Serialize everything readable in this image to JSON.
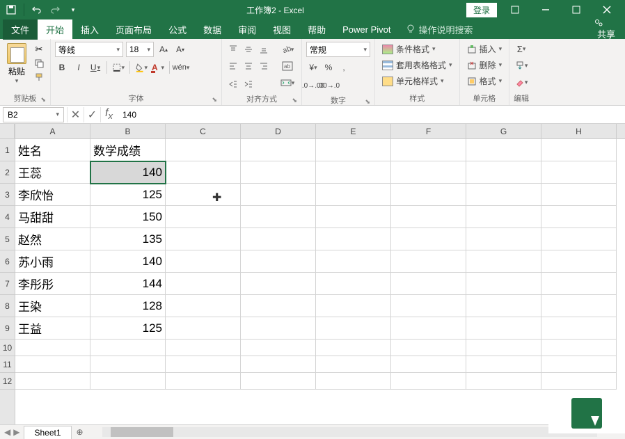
{
  "titlebar": {
    "title": "工作簿2 - Excel",
    "login": "登录"
  },
  "menubar": {
    "file": "文件",
    "home": "开始",
    "insert": "插入",
    "page_layout": "页面布局",
    "formulas": "公式",
    "data": "数据",
    "review": "审阅",
    "view": "视图",
    "help": "帮助",
    "power_pivot": "Power Pivot",
    "tell_me": "操作说明搜索",
    "share": "共享"
  },
  "ribbon": {
    "clipboard": {
      "label": "剪贴板",
      "paste": "粘贴"
    },
    "font": {
      "label": "字体",
      "name": "等线",
      "size": "18"
    },
    "alignment": {
      "label": "对齐方式"
    },
    "number": {
      "label": "数字",
      "format": "常规"
    },
    "styles": {
      "label": "样式",
      "conditional": "条件格式",
      "table": "套用表格格式",
      "cell": "单元格样式"
    },
    "cells": {
      "label": "单元格",
      "insert": "插入",
      "delete": "删除",
      "format": "格式"
    },
    "editing": {
      "label": "编辑"
    }
  },
  "formula_bar": {
    "name_box": "B2",
    "value": "140"
  },
  "columns": [
    "A",
    "B",
    "C",
    "D",
    "E",
    "F",
    "G",
    "H"
  ],
  "rows": [
    "1",
    "2",
    "3",
    "4",
    "5",
    "6",
    "7",
    "8",
    "9",
    "10",
    "11",
    "12"
  ],
  "data": {
    "headers": {
      "a": "姓名",
      "b": "数学成绩"
    },
    "rows": [
      {
        "a": "王蕊",
        "b": "140"
      },
      {
        "a": "李欣怡",
        "b": "125"
      },
      {
        "a": "马甜甜",
        "b": "150"
      },
      {
        "a": "赵然",
        "b": "135"
      },
      {
        "a": "苏小雨",
        "b": "140"
      },
      {
        "a": "李彤彤",
        "b": "144"
      },
      {
        "a": "王染",
        "b": "128"
      },
      {
        "a": "王益",
        "b": "125"
      }
    ]
  },
  "sheet_tabs": {
    "sheet1": "Sheet1"
  },
  "chart_data": {
    "type": "table",
    "columns": [
      "姓名",
      "数学成绩"
    ],
    "rows": [
      [
        "王蕊",
        140
      ],
      [
        "李欣怡",
        125
      ],
      [
        "马甜甜",
        150
      ],
      [
        "赵然",
        135
      ],
      [
        "苏小雨",
        140
      ],
      [
        "李彤彤",
        144
      ],
      [
        "王染",
        128
      ],
      [
        "王益",
        125
      ]
    ]
  }
}
